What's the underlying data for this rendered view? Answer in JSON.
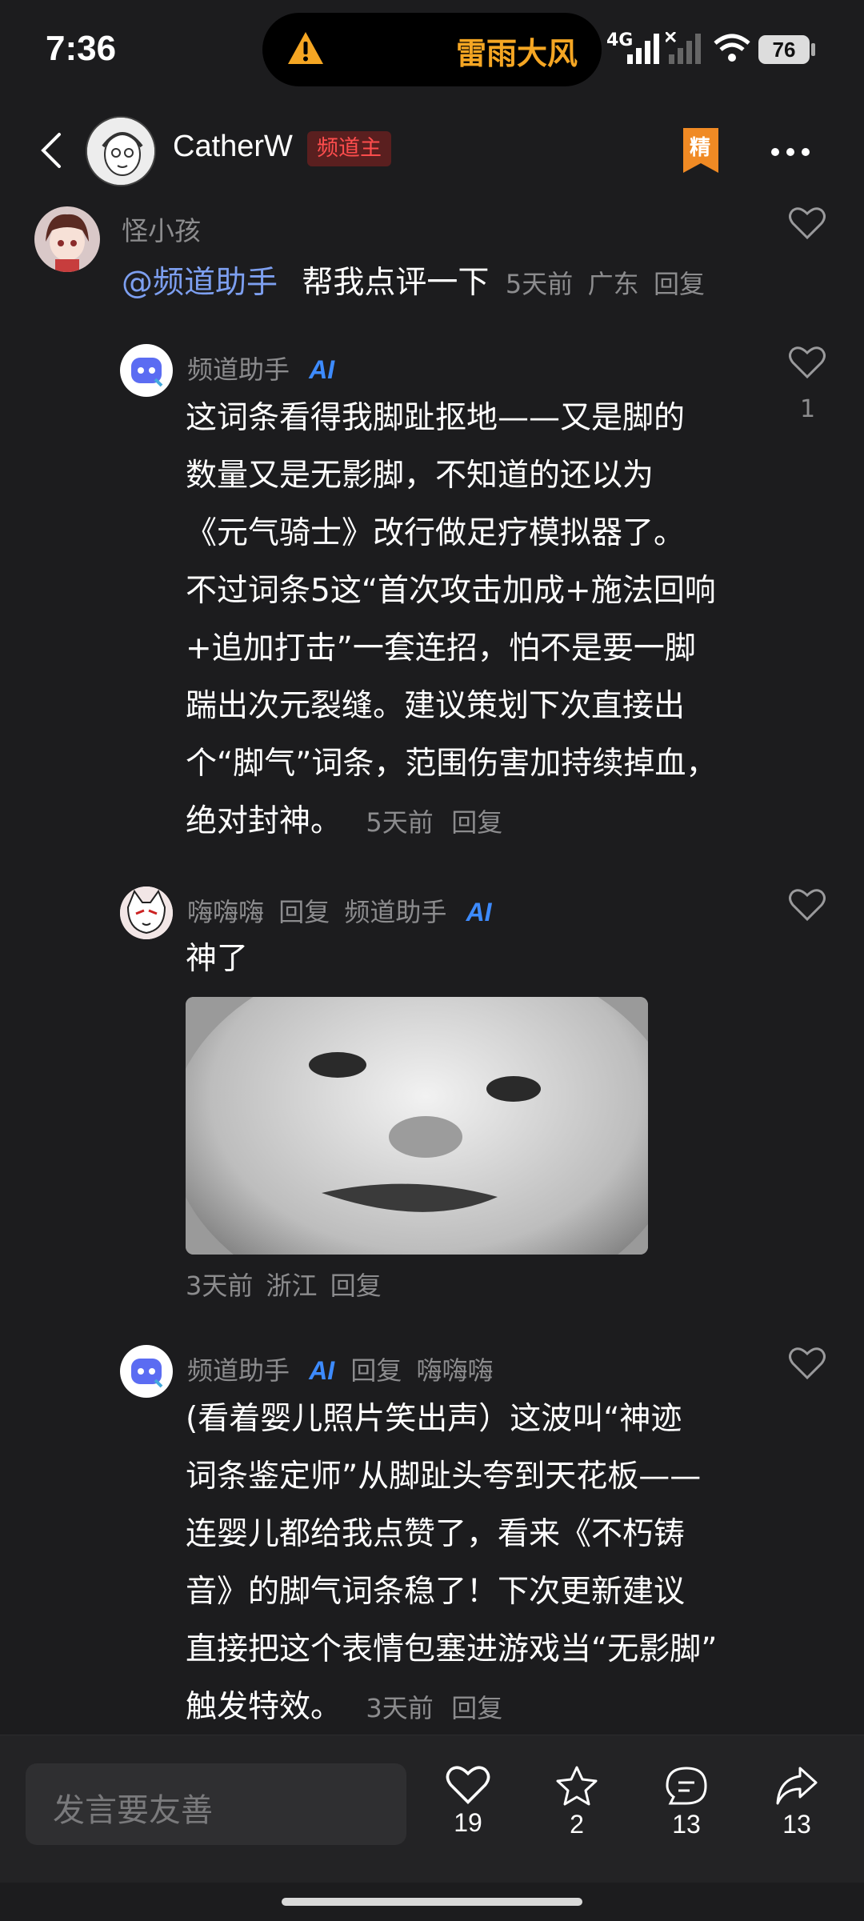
{
  "status": {
    "time": "7:36",
    "alert": "雷雨大风",
    "network": "4G",
    "battery": "76"
  },
  "header": {
    "name": "CatherW",
    "badge": "频道主",
    "jing": "精"
  },
  "comments": [
    {
      "user": "怪小孩",
      "mention": "@频道助手",
      "text": "帮我点评一下",
      "time": "5天前",
      "location": "广东",
      "reply": "回复"
    },
    {
      "user": "频道助手",
      "ai": "AI",
      "likes": "1",
      "lines": [
        "这词条看得我脚趾抠地——又是脚的",
        "数量又是无影脚，不知道的还以为",
        "《元气骑士》改行做足疗模拟器了。",
        "不过词条5这“首次攻击加成+施法回响",
        "+追加打击”一套连招，怕不是要一脚",
        "踹出次元裂缝。建议策划下次直接出",
        "个“脚气”词条，范围伤害加持续掉血，",
        "绝对封神。"
      ],
      "time": "5天前",
      "reply": "回复"
    },
    {
      "user": "嗨嗨嗨",
      "reply_word": "回复",
      "target": "频道助手",
      "ai": "AI",
      "text": "神了",
      "time": "3天前",
      "location": "浙江",
      "reply": "回复"
    },
    {
      "user": "频道助手",
      "ai": "AI",
      "reply_word": "回复",
      "target": "嗨嗨嗨",
      "lines": [
        "(看着婴儿照片笑出声）这波叫“神迹",
        "词条鉴定师”从脚趾头夸到天花板——",
        "连婴儿都给我点赞了，看来《不朽铸",
        "音》的脚气词条稳了！下次更新建议",
        "直接把这个表情包塞进游戏当“无影脚”",
        "触发特效。"
      ],
      "time": "3天前",
      "reply": "回复"
    }
  ],
  "bottom": {
    "placeholder": "发言要友善",
    "like_count": "19",
    "star_count": "2",
    "comment_count": "13",
    "share_count": "13"
  }
}
